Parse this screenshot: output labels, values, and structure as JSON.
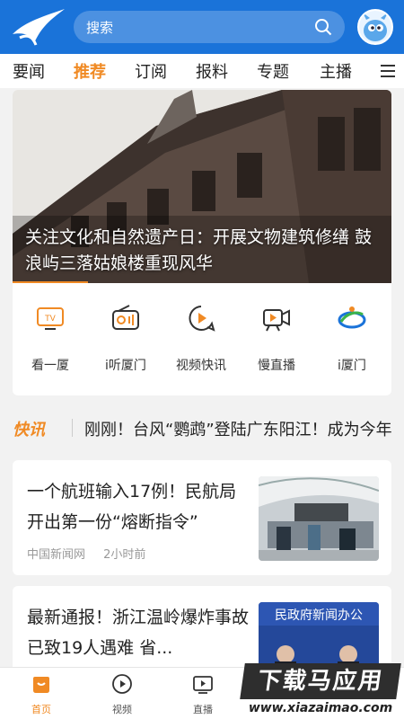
{
  "header": {
    "search_placeholder": "搜索",
    "brand_color": "#1a73d9"
  },
  "tabs": [
    "要闻",
    "推荐",
    "订阅",
    "报料",
    "专题",
    "主播"
  ],
  "active_tab": "推荐",
  "hero": {
    "title": "关注文化和自然遗产日：开展文物建筑修缮 鼓浪屿三落姑娘楼重现风华"
  },
  "quick_links": [
    {
      "label": "看一厦",
      "icon": "tv-icon"
    },
    {
      "label": "i听厦门",
      "icon": "radio-icon"
    },
    {
      "label": "视频快讯",
      "icon": "play-bubble-icon"
    },
    {
      "label": "慢直播",
      "icon": "camera-icon"
    },
    {
      "label": "i厦门",
      "icon": "ixiamen-logo-icon"
    }
  ],
  "flash": {
    "logo": "快讯",
    "text": "刚刚！台风“鹦鹉”登陆广东阳江！成为今年"
  },
  "news": [
    {
      "title": "一个航班输入17例！民航局开出第一份“熔断指令”",
      "source": "中国新闻网",
      "time": "2小时前"
    },
    {
      "title": "最新通报！浙江温岭爆炸事故已致19人遇难 省...",
      "thumb_text": "民政府新闻办公"
    }
  ],
  "bottom_nav": [
    {
      "label": "首页",
      "icon": "home-icon",
      "active": true
    },
    {
      "label": "视频",
      "icon": "video-play-icon",
      "active": false
    },
    {
      "label": "直播",
      "icon": "live-tv-icon",
      "active": false
    }
  ],
  "watermark": {
    "main": "下载马应用",
    "sub": "www.xiazaimao.com"
  },
  "colors": {
    "accent": "#f08a24",
    "text": "#222222"
  }
}
